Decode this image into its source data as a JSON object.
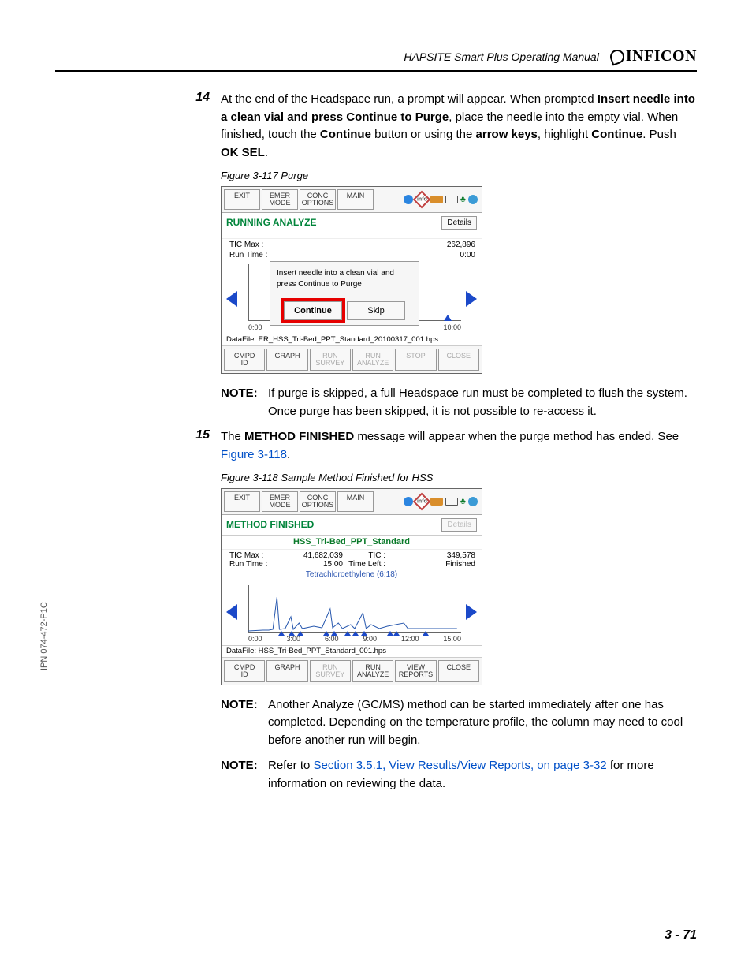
{
  "header": {
    "title": "HAPSITE Smart Plus Operating Manual",
    "brand": "INFICON"
  },
  "sideCode": "IPN 074-472-P1C",
  "pageNumber": "3 - 71",
  "step14": {
    "num": "14",
    "t1": "At the end of the Headspace run, a prompt will appear. When prompted ",
    "b1": "Insert needle into a clean vial and press Continue to Purge",
    "t2": ", place the needle into the empty vial. When finished, touch the ",
    "b2": "Continue",
    "t3": " button or using the ",
    "b3": "arrow keys",
    "t4": ", highlight ",
    "b4": "Continue",
    "t5": ". Push ",
    "b5": "OK SEL",
    "t6": "."
  },
  "fig117": {
    "caption": "Figure 3-117  Purge",
    "topButtons": [
      "EXIT",
      "EMER\nMODE",
      "CONC\nOPTIONS",
      "MAIN"
    ],
    "status": "RUNNING ANALYZE",
    "details": "Details",
    "ticMaxLabel": "TIC Max :",
    "runTimeLabel": "Run Time :",
    "ticMaxVal": "262,896",
    "runTimeVal": "0:00",
    "dialogMsg": "Insert needle into a clean vial and press Continue to Purge",
    "dialogBtns": [
      "Continue",
      "Skip"
    ],
    "xTicks": [
      "0:00",
      "10:00"
    ],
    "dataFile": "DataFile: ER_HSS_Tri-Bed_PPT_Standard_20100317_001.hps",
    "bottom": {
      "cmpd": "CMPD\nID",
      "graph": "GRAPH",
      "runSurvey": "RUN\nSURVEY",
      "runAnalyze": "RUN\nANALYZE",
      "stop": "STOP",
      "close": "CLOSE"
    }
  },
  "note1": {
    "label": "NOTE:",
    "text": "If purge is skipped, a full Headspace run must be completed to flush the system. Once purge has been skipped, it is not possible to re-access it."
  },
  "step15": {
    "num": "15",
    "t1": "The ",
    "b1": "METHOD FINISHED",
    "t2": " message will appear when the purge method has ended. See ",
    "link": "Figure 3-118",
    "t3": "."
  },
  "fig118": {
    "caption": "Figure 3-118  Sample Method Finished for HSS",
    "topButtons": [
      "EXIT",
      "EMER\nMODE",
      "CONC\nOPTIONS",
      "MAIN"
    ],
    "status": "METHOD FINISHED",
    "details": "Details",
    "methodName": "HSS_Tri-Bed_PPT_Standard",
    "ticMaxLabel": "TIC Max :",
    "ticMaxVal": "41,682,039",
    "ticLabel": "TIC :",
    "ticVal": "349,578",
    "runTimeLabel": "Run Time :",
    "runTimeVal": "15:00",
    "timeLeftLabel": "Time Left :",
    "timeLeftVal": "Finished",
    "compound": "Tetrachloroethylene (6:18)",
    "xTicks": [
      "0:00",
      "3:00",
      "6:00",
      "9:00",
      "12:00",
      "15:00"
    ],
    "dataFile": "DataFile: HSS_Tri-Bed_PPT_Standard_001.hps",
    "bottom": {
      "cmpd": "CMPD\nID",
      "graph": "GRAPH",
      "runSurvey": "RUN\nSURVEY",
      "runAnalyze": "RUN\nANALYZE",
      "viewReports": "VIEW\nREPORTS",
      "close": "CLOSE"
    }
  },
  "note2": {
    "label": "NOTE:",
    "text": "Another Analyze (GC/MS) method can be started immediately after one has completed. Depending on the temperature profile, the column may need to cool before another run will begin."
  },
  "note3": {
    "label": "NOTE:",
    "t1": "Refer to ",
    "link": "Section 3.5.1, View Results/View Reports, on page 3-32",
    "t2": " for more information on reviewing the data."
  }
}
